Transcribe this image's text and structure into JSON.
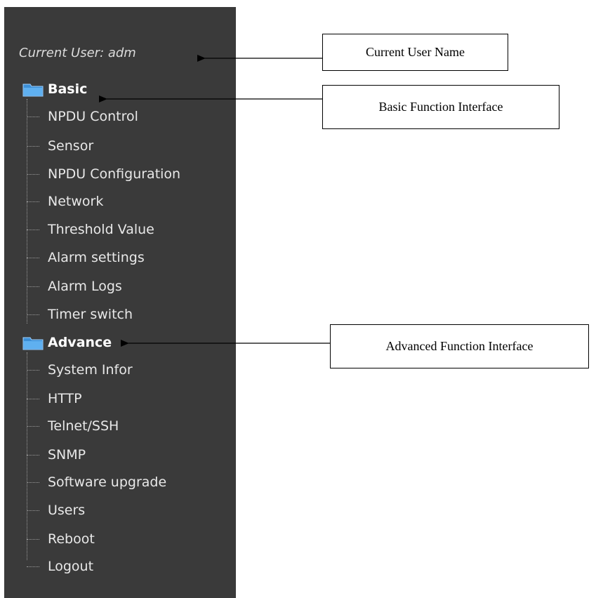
{
  "sidebar": {
    "current_user_label": "Current User: adm",
    "groups": [
      {
        "label": "Basic",
        "icon": "folder-icon",
        "items": [
          {
            "label": "NPDU Control"
          },
          {
            "label": "Sensor"
          },
          {
            "label": "NPDU Configuration"
          },
          {
            "label": "Network"
          },
          {
            "label": "Threshold Value"
          },
          {
            "label": "Alarm settings"
          },
          {
            "label": "Alarm Logs"
          },
          {
            "label": "Timer switch"
          }
        ]
      },
      {
        "label": "Advance",
        "icon": "folder-icon",
        "items": [
          {
            "label": "System Infor"
          },
          {
            "label": "HTTP"
          },
          {
            "label": "Telnet/SSH"
          },
          {
            "label": "SNMP"
          },
          {
            "label": "Software upgrade"
          },
          {
            "label": "Users"
          },
          {
            "label": "Reboot"
          },
          {
            "label": "Logout"
          }
        ]
      }
    ]
  },
  "callouts": {
    "current_user": "Current User Name",
    "basic": "Basic Function Interface",
    "advanced": "Advanced Function Interface"
  },
  "colors": {
    "panel_bg": "#3a3a3a",
    "text": "#e8e8e8",
    "folder": "#3c8fd6"
  }
}
